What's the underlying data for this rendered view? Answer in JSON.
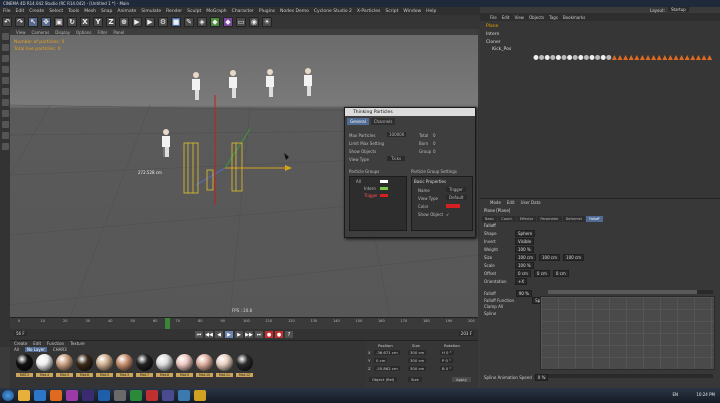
{
  "window": {
    "title": "CINEMA 4D R14.042 Studio (RC R14.042) - [Untitled 1 *] - Main"
  },
  "menubar": [
    "File",
    "Edit",
    "Create",
    "Select",
    "Tools",
    "Mesh",
    "Snap",
    "Animate",
    "Simulate",
    "Render",
    "Sculpt",
    "MoGraph",
    "Character",
    "Plugins",
    "Nodes Demo",
    "Cyclone Studio 2",
    "X-Particles",
    "Script",
    "Window",
    "Help"
  ],
  "toolbar_letters": [
    "X",
    "Y",
    "Z"
  ],
  "viewport": {
    "menu": [
      "View",
      "Cameras",
      "Display",
      "Options",
      "Filter",
      "Panel"
    ],
    "hud_particles": "Number of particles: 0",
    "hud_total": "Total live particles: 0",
    "distance_label": "272.528 cm",
    "fps_label": "FPS : 20.8"
  },
  "thinking_particles": {
    "title": "Thinking Particles",
    "tabs": [
      "General",
      "Channels"
    ],
    "max_particles_label": "Max Particles",
    "max_particles_value": "100000",
    "total_label": "Total",
    "total_value": "0",
    "limit_label": "Limit Max Setting",
    "born_label": "Born",
    "born_value": "0",
    "show_objects_label": "Show Objects",
    "group_label": "Group",
    "group_value": "0",
    "view_type_label": "View Type",
    "view_type_value": "Ticks",
    "groups_header": "Particle Groups",
    "group_settings_header": "Particle Group Settings",
    "groups": [
      "All",
      "Intern",
      "Trigger"
    ],
    "basic_props": "Basic Properties",
    "name_label": "Name",
    "name_value": "Trigger",
    "viewtype_label": "View Type",
    "viewtype_value": "Default",
    "color_label": "Color",
    "show_object_label": "Show Object",
    "colors": {
      "all": "#ffffff",
      "intern": "#7ec84a",
      "trigger": "#d42020"
    }
  },
  "object_manager": {
    "menu": [
      "File",
      "Edit",
      "View",
      "Objects",
      "Tags",
      "Bookmarks"
    ],
    "items": [
      "Plane",
      "Intern",
      "Cloner",
      "Kick_Pos"
    ],
    "layout_label": "Layout:",
    "layout_value": "Startup"
  },
  "attributes": {
    "menu": [
      "Mode",
      "Edit",
      "User Data"
    ],
    "object_name": "Plane [Plane]",
    "tabs": [
      "Basic",
      "Coord.",
      "Effector",
      "Parameter",
      "Deformer",
      "Falloff"
    ],
    "section": "Falloff",
    "rows": [
      {
        "label": "Shape",
        "value": "Sphere"
      },
      {
        "label": "Invert",
        "value": "Visible"
      },
      {
        "label": "Weight",
        "value": "100 %"
      },
      {
        "label": "Size",
        "value": "100 cm",
        "value2": "100 cm",
        "value3": "100 cm"
      },
      {
        "label": "Scale",
        "value": "100 %"
      },
      {
        "label": "Offset",
        "value": "0 cm",
        "value2": "0 cm",
        "value3": "0 cm"
      },
      {
        "label": "Orientation",
        "value": "+X"
      }
    ],
    "falloff_label": "Falloff",
    "falloff_value": "90 %",
    "falloff_function_label": "Falloff Function",
    "falloff_function_value": "Spline",
    "clamp_label": "Clamp All",
    "spline_label": "Spline",
    "spline_anim_label": "Spline Animation Speed",
    "spline_anim_value": "0 %"
  },
  "timeline": {
    "ticks": [
      "0",
      "10",
      "20",
      "30",
      "40",
      "50",
      "60",
      "70",
      "80",
      "90",
      "100",
      "110",
      "120",
      "130",
      "140",
      "150",
      "160",
      "170",
      "180",
      "190",
      "200"
    ],
    "current_frame": "56 F",
    "end_frame": "203 F"
  },
  "materials": {
    "menu": [
      "Create",
      "Edit",
      "Function",
      "Texture"
    ],
    "filter": [
      "All",
      "No Layer",
      "CHAR3"
    ],
    "labels": [
      "MAT.2",
      "Mat.4",
      "Mat.5",
      "Mat.6",
      "Mat.5",
      "Mat.3",
      "Mat.7",
      "Mat.8",
      "Mat.9",
      "Mat.10",
      "Mat.11",
      "Mat.12"
    ]
  },
  "coordinates": {
    "headers": [
      "Position",
      "Size",
      "Rotation"
    ],
    "x": [
      "-36.671 cm",
      "300 cm",
      "H 0 °"
    ],
    "y": [
      "0 cm",
      "300 cm",
      "P 0 °"
    ],
    "z": [
      "-55.862 cm",
      "300 cm",
      "B 0 °"
    ],
    "mode": "Object (Rel)",
    "size_mode": "Size",
    "apply": "Apply"
  },
  "taskbar": {
    "lang": "EN",
    "time": "10:24 PM"
  }
}
